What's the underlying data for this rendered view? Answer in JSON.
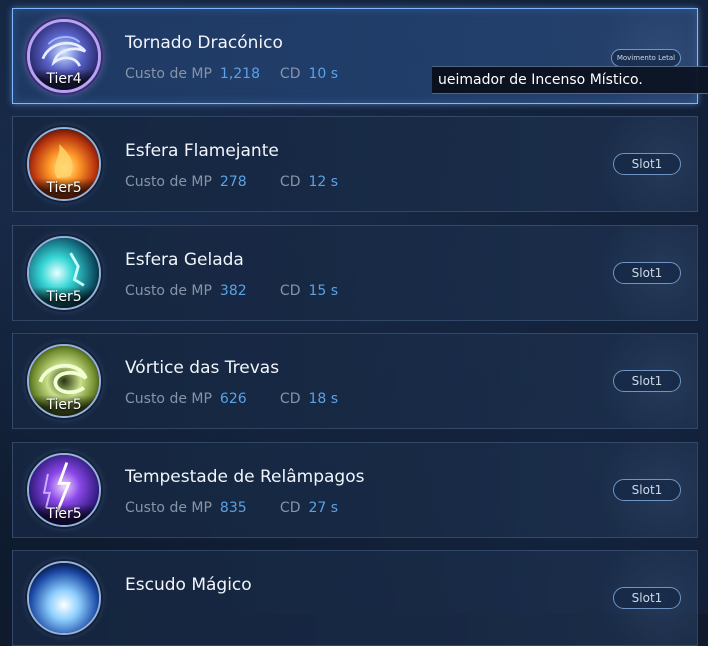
{
  "colors": {
    "accent_value": "#5aa2e6",
    "label": "#8794a8",
    "selected_border": "#7eb6ff"
  },
  "labels": {
    "mp": "Custo de MP",
    "cd": "CD"
  },
  "tooltip": {
    "text": "ueimador de Incenso Místico."
  },
  "skills": [
    {
      "name": "Tornado Dracónico",
      "tier": "Tier4",
      "mp": "1,218",
      "cd": "10 s",
      "slot": "Movimento Letal",
      "icon": "dragon-tornado-icon",
      "selected": true
    },
    {
      "name": "Esfera Flamejante",
      "tier": "Tier5",
      "mp": "278",
      "cd": "12 s",
      "slot": "Slot1",
      "icon": "fire-orb-icon"
    },
    {
      "name": "Esfera Gelada",
      "tier": "Tier5",
      "mp": "382",
      "cd": "15 s",
      "slot": "Slot1",
      "icon": "ice-orb-icon"
    },
    {
      "name": "Vórtice das Trevas",
      "tier": "Tier5",
      "mp": "626",
      "cd": "18 s",
      "slot": "Slot1",
      "icon": "dark-vortex-icon"
    },
    {
      "name": "Tempestade de Relâmpagos",
      "tier": "Tier5",
      "mp": "835",
      "cd": "27 s",
      "slot": "Slot1",
      "icon": "lightning-storm-icon"
    },
    {
      "name": "Escudo Mágico",
      "tier": "",
      "mp": "",
      "cd": "",
      "slot": "Slot1",
      "icon": "magic-shield-icon"
    }
  ]
}
